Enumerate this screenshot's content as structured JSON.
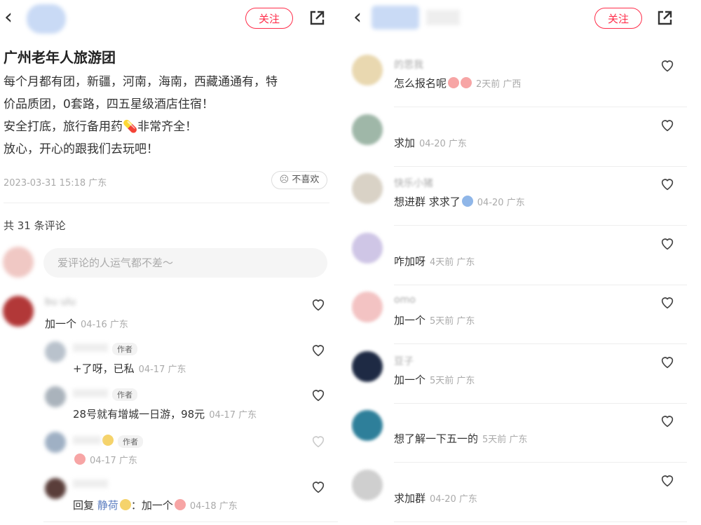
{
  "left": {
    "title": "广州老年人旅游团",
    "follow_label": "关注",
    "body_lines": [
      "每个月都有团，新疆，河南，海南，西藏通通有，特",
      "价品质团，0套路，四五星级酒店住宿！",
      "安全打底，旅行备用药💊非常齐全！",
      "放心，开心的跟我们去玩吧！"
    ],
    "post_meta": "2023-03-31 15:18 广东",
    "dislike_label": "不喜欢",
    "comment_count": "共 31 条评论",
    "comment_placeholder": "爱评论的人运气都不差～",
    "comments": [
      {
        "name": "bu  ulu",
        "text": "加一个",
        "meta": "04-16 广东"
      },
      {
        "name": "",
        "tag": "作者",
        "text": "+了呀，已私",
        "meta": "04-17 广东"
      },
      {
        "name": "",
        "tag": "作者",
        "text": "28号就有增城一日游，98元",
        "meta": "04-17 广东"
      },
      {
        "name": "",
        "tag": "作者",
        "text": "",
        "meta": "04-17 广东"
      },
      {
        "name": "",
        "text_prefix": "回复",
        "reply_to": "静荷",
        "text": "：加一个",
        "meta": "04-18 广东"
      }
    ]
  },
  "right": {
    "follow_label": "关注",
    "comments": [
      {
        "name": "的思我",
        "text": "怎么报名呢",
        "meta": "2天前 广西"
      },
      {
        "name": "",
        "text": "求加",
        "meta": "04-20 广东"
      },
      {
        "name": "快乐小猪",
        "text": "想进群 求求了",
        "meta": "04-20 广东"
      },
      {
        "name": "",
        "text": "咋加呀",
        "meta": "4天前 广东"
      },
      {
        "name": "omo",
        "text": "加一个",
        "meta": "5天前 广东"
      },
      {
        "name": "豆子",
        "text": "加一个",
        "meta": "5天前 广东"
      },
      {
        "name": "",
        "text": "想了解一下五一的",
        "meta": "5天前 广东"
      },
      {
        "name": "",
        "text": "求加群",
        "meta": "04-20 广东"
      }
    ]
  },
  "colors": {
    "accent": "#ff2d4a",
    "meta": "#aaaaaa",
    "separator": "#eeeeee"
  }
}
